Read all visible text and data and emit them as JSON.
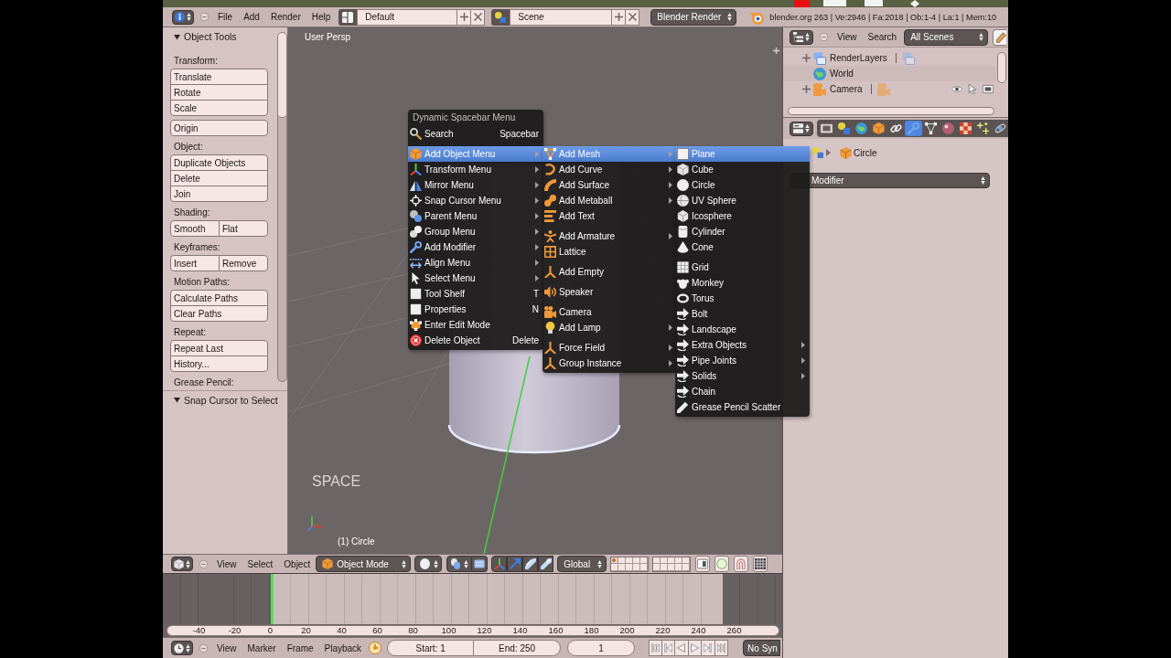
{
  "info_header": {
    "menus": [
      "File",
      "Add",
      "Render",
      "Help"
    ],
    "screen_layout": "Default",
    "scene": "Scene",
    "render_engine": "Blender Render",
    "stats": "blender.org 263 | Ve:2946 | Fa:2018 | Ob:1-4 | La:1 | Mem:10"
  },
  "tool_shelf": {
    "panels": [
      {
        "title": "Object Tools",
        "expanded": true,
        "sections": [
          {
            "label": "Transform:",
            "groups": [
              {
                "kind": "column",
                "buttons": [
                  "Translate",
                  "Rotate",
                  "Scale"
                ]
              },
              {
                "kind": "column",
                "buttons": [
                  "Origin"
                ]
              }
            ]
          },
          {
            "label": "Object:",
            "groups": [
              {
                "kind": "column",
                "buttons": [
                  "Duplicate Objects",
                  "Delete",
                  "Join"
                ]
              }
            ]
          },
          {
            "label": "Shading:",
            "groups": [
              {
                "kind": "row",
                "buttons": [
                  "Smooth",
                  "Flat"
                ]
              }
            ]
          },
          {
            "label": "Keyframes:",
            "groups": [
              {
                "kind": "row",
                "buttons": [
                  "Insert",
                  "Remove"
                ]
              }
            ]
          },
          {
            "label": "Motion Paths:",
            "groups": [
              {
                "kind": "column",
                "buttons": [
                  "Calculate Paths",
                  "Clear Paths"
                ]
              }
            ]
          },
          {
            "label": "Repeat:",
            "groups": [
              {
                "kind": "column",
                "buttons": [
                  "Repeat Last",
                  "History..."
                ]
              }
            ]
          },
          {
            "label": "Grease Pencil:"
          }
        ]
      },
      {
        "title": "Snap Cursor to Select",
        "expanded": true
      }
    ]
  },
  "viewport": {
    "view_name": "User Persp",
    "overlay_text": "SPACE",
    "object_info": "(1) Circle"
  },
  "spacebar_menu": {
    "title": "Dynamic Spacebar Menu",
    "columns": [
      {
        "groups": [
          [
            {
              "label": "Search",
              "shortcut": "Spacebar",
              "submenu": false,
              "selected": false
            }
          ],
          [
            {
              "label": "Add Object Menu",
              "submenu": true,
              "selected": true
            },
            {
              "label": "Transform Menu",
              "submenu": true,
              "selected": false
            },
            {
              "label": "Mirror Menu",
              "submenu": true,
              "selected": false
            },
            {
              "label": "Snap Cursor Menu",
              "submenu": true,
              "selected": false
            },
            {
              "label": "Parent Menu",
              "submenu": true,
              "selected": false
            },
            {
              "label": "Group Menu",
              "submenu": true,
              "selected": false
            },
            {
              "label": "Add Modifier",
              "submenu": true,
              "selected": false
            },
            {
              "label": "Align Menu",
              "submenu": true,
              "selected": false
            },
            {
              "label": "Select Menu",
              "submenu": true,
              "selected": false
            },
            {
              "label": "Tool Shelf",
              "shortcut": "T",
              "submenu": false,
              "selected": false
            },
            {
              "label": "Properties",
              "shortcut": "N",
              "submenu": false,
              "selected": false
            },
            {
              "label": "Enter Edit Mode",
              "submenu": false,
              "selected": false
            },
            {
              "label": "Delete Object",
              "shortcut": "Delete",
              "submenu": false,
              "selected": false
            }
          ]
        ]
      },
      {
        "groups": [
          [
            {
              "label": "Add Mesh",
              "submenu": true,
              "selected": true
            },
            {
              "label": "Add Curve",
              "submenu": true,
              "selected": false
            },
            {
              "label": "Add Surface",
              "submenu": true,
              "selected": false
            },
            {
              "label": "Add Metaball",
              "submenu": true,
              "selected": false
            },
            {
              "label": "Add Text",
              "submenu": false,
              "selected": false
            }
          ],
          [
            {
              "label": "Add Armature",
              "submenu": true,
              "selected": false
            },
            {
              "label": "Lattice",
              "submenu": false,
              "selected": false
            }
          ],
          [
            {
              "label": "Add Empty",
              "submenu": false,
              "selected": false
            }
          ],
          [
            {
              "label": "Speaker",
              "submenu": false,
              "selected": false
            }
          ],
          [
            {
              "label": "Camera",
              "submenu": false,
              "selected": false
            },
            {
              "label": "Add Lamp",
              "submenu": true,
              "selected": false
            }
          ],
          [
            {
              "label": "Force Field",
              "submenu": true,
              "selected": false
            },
            {
              "label": "Group Instance",
              "submenu": true,
              "selected": false
            }
          ]
        ]
      },
      {
        "groups": [
          [
            {
              "label": "Plane",
              "submenu": false,
              "selected": true
            },
            {
              "label": "Cube",
              "submenu": false,
              "selected": false
            },
            {
              "label": "Circle",
              "submenu": false,
              "selected": false
            },
            {
              "label": "UV Sphere",
              "submenu": false,
              "selected": false
            },
            {
              "label": "Icosphere",
              "submenu": false,
              "selected": false
            },
            {
              "label": "Cylinder",
              "submenu": false,
              "selected": false
            },
            {
              "label": "Cone",
              "submenu": false,
              "selected": false
            }
          ],
          [
            {
              "label": "Grid",
              "submenu": false,
              "selected": false
            },
            {
              "label": "Monkey",
              "submenu": false,
              "selected": false
            },
            {
              "label": "Torus",
              "submenu": false,
              "selected": false
            },
            {
              "label": "Bolt",
              "submenu": false,
              "selected": false
            },
            {
              "label": "Landscape",
              "submenu": false,
              "selected": false
            },
            {
              "label": "Extra Objects",
              "submenu": true,
              "selected": false
            },
            {
              "label": "Pipe Joints",
              "submenu": true,
              "selected": false
            },
            {
              "label": "Solids",
              "submenu": true,
              "selected": false
            },
            {
              "label": "Chain",
              "submenu": false,
              "selected": false
            },
            {
              "label": "Grease Pencil Scatter",
              "submenu": false,
              "selected": false
            }
          ]
        ]
      }
    ]
  },
  "outliner": {
    "menus": [
      "View",
      "Search"
    ],
    "filter": "All Scenes",
    "items": [
      {
        "kind": "layers",
        "label": "RenderLayers",
        "has_children": true
      },
      {
        "kind": "world",
        "label": "World",
        "has_children": false
      },
      {
        "kind": "camera",
        "label": "Camera",
        "has_children": true
      }
    ]
  },
  "properties": {
    "tabs": [
      {
        "selected": false
      },
      {
        "selected": false
      },
      {
        "selected": false
      },
      {
        "selected": false
      },
      {
        "selected": false
      },
      {
        "selected": true
      },
      {
        "selected": false
      },
      {
        "selected": false
      },
      {
        "selected": false
      },
      {
        "selected": false
      },
      {
        "selected": false
      }
    ],
    "breadcrumb": "Circle",
    "modifier_menu": "Modifier"
  },
  "view3d_header": {
    "menus": [
      "View",
      "Select",
      "Object"
    ],
    "mode": "Object Mode",
    "orientation": "Global",
    "layers": [
      {
        "selected": true
      },
      {
        "selected": false
      },
      {
        "selected": false
      },
      {
        "selected": false
      },
      {
        "selected": false
      },
      {
        "selected": false
      },
      {
        "selected": false
      },
      {
        "selected": false
      },
      {
        "selected": false
      },
      {
        "selected": false
      },
      {
        "selected": false
      },
      {
        "selected": false
      },
      {
        "selected": false
      },
      {
        "selected": false
      },
      {
        "selected": false
      },
      {
        "selected": false
      },
      {
        "selected": false
      },
      {
        "selected": false
      },
      {
        "selected": false
      },
      {
        "selected": false
      }
    ]
  },
  "timeline": {
    "ruler": [
      "-40",
      "-20",
      "0",
      "20",
      "40",
      "60",
      "80",
      "100",
      "120",
      "140",
      "160",
      "180",
      "200",
      "220",
      "240",
      "260"
    ],
    "menus": [
      "View",
      "Marker",
      "Frame",
      "Playback"
    ],
    "start": "Start: 1",
    "end": "End: 250",
    "current_frame": "1",
    "sync": "No Syn"
  }
}
